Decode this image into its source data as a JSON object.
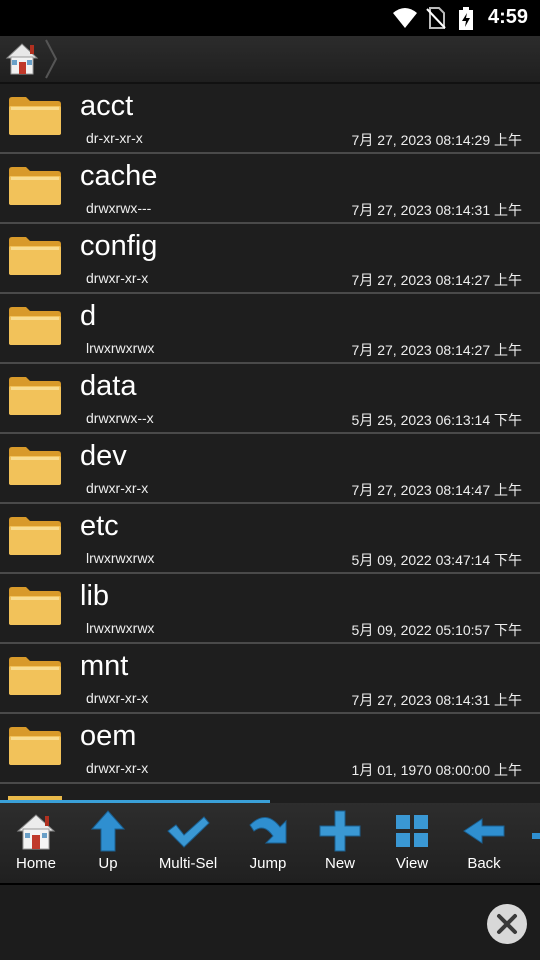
{
  "status_bar": {
    "time": "4:59",
    "icons": [
      "wifi-icon",
      "no-sim-icon",
      "battery-charging-icon"
    ]
  },
  "path_bar": {
    "home_icon": "home-icon"
  },
  "files": [
    {
      "name": "acct",
      "perm": "dr-xr-xr-x",
      "date": "7月 27, 2023 08:14:29 上午"
    },
    {
      "name": "cache",
      "perm": "drwxrwx---",
      "date": "7月 27, 2023 08:14:31 上午"
    },
    {
      "name": "config",
      "perm": "drwxr-xr-x",
      "date": "7月 27, 2023 08:14:27 上午"
    },
    {
      "name": "d",
      "perm": "lrwxrwxrwx",
      "date": "7月 27, 2023 08:14:27 上午"
    },
    {
      "name": "data",
      "perm": "drwxrwx--x",
      "date": "5月 25, 2023 06:13:14 下午"
    },
    {
      "name": "dev",
      "perm": "drwxr-xr-x",
      "date": "7月 27, 2023 08:14:47 上午"
    },
    {
      "name": "etc",
      "perm": "lrwxrwxrwx",
      "date": "5月 09, 2022 03:47:14 下午"
    },
    {
      "name": "lib",
      "perm": "lrwxrwxrwx",
      "date": "5月 09, 2022 05:10:57 下午"
    },
    {
      "name": "mnt",
      "perm": "drwxr-xr-x",
      "date": "7月 27, 2023 08:14:31 上午"
    },
    {
      "name": "oem",
      "perm": "drwxr-xr-x",
      "date": "1月 01, 1970 08:00:00 上午"
    }
  ],
  "toolbar": {
    "home": "Home",
    "up": "Up",
    "multi_sel": "Multi-Sel",
    "jump": "Jump",
    "new": "New",
    "view": "View",
    "back": "Back"
  },
  "colors": {
    "accent": "#3aa0d8",
    "folder": "#f0c055",
    "background": "#1e1e1e"
  }
}
